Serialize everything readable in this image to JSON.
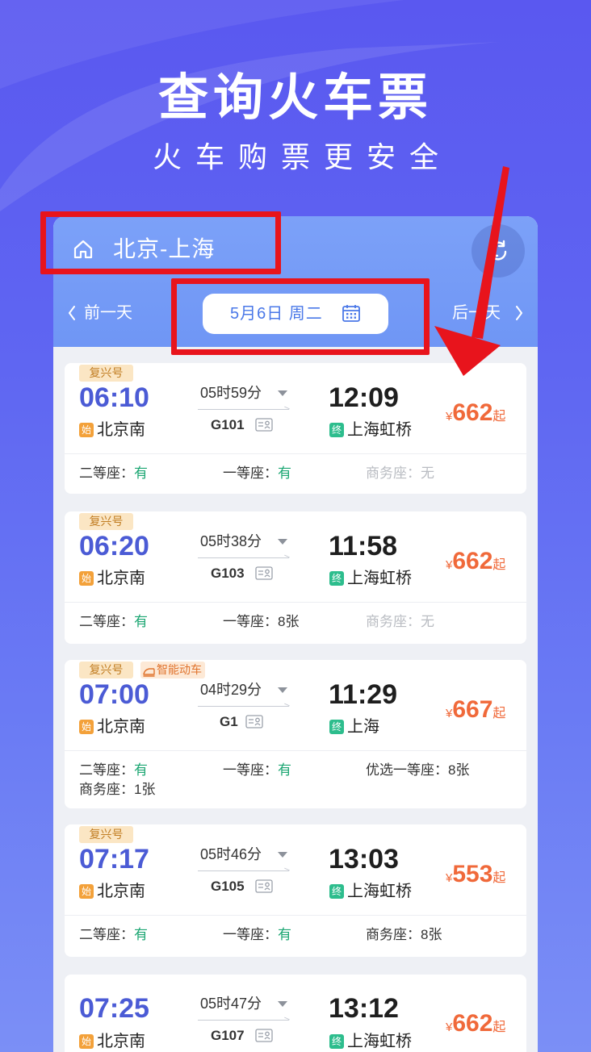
{
  "promo": {
    "title": "查询火车票",
    "subtitle": "火车购票更安全"
  },
  "route": {
    "label": "北京-上海"
  },
  "date_nav": {
    "prev_label": "前一天",
    "date_label": "5月6日 周二",
    "next_label": "后一天"
  },
  "trains": [
    {
      "badges": [
        "复兴号"
      ],
      "depart_time": "06:10",
      "depart_tag": "始",
      "depart_station": "北京南",
      "duration": "05时59分",
      "train_no": "G101",
      "arrive_time": "12:09",
      "arrive_tag": "终",
      "arrive_station": "上海虹桥",
      "price": {
        "currency": "¥",
        "amount": "662",
        "suffix": "起"
      },
      "seats": [
        {
          "label": "二等座：",
          "status": "有"
        },
        {
          "label": "一等座：",
          "status": "有"
        },
        {
          "label": "商务座：",
          "status": "无"
        }
      ]
    },
    {
      "badges": [
        "复兴号"
      ],
      "depart_time": "06:20",
      "depart_tag": "始",
      "depart_station": "北京南",
      "duration": "05时38分",
      "train_no": "G103",
      "arrive_time": "11:58",
      "arrive_tag": "终",
      "arrive_station": "上海虹桥",
      "price": {
        "currency": "¥",
        "amount": "662",
        "suffix": "起"
      },
      "seats": [
        {
          "label": "二等座：",
          "status": "有"
        },
        {
          "label": "一等座：",
          "status": "8张"
        },
        {
          "label": "商务座：",
          "status": "无"
        }
      ]
    },
    {
      "badges": [
        "复兴号",
        "智能动车"
      ],
      "depart_time": "07:00",
      "depart_tag": "始",
      "depart_station": "北京南",
      "duration": "04时29分",
      "train_no": "G1",
      "arrive_time": "11:29",
      "arrive_tag": "终",
      "arrive_station": "上海",
      "price": {
        "currency": "¥",
        "amount": "667",
        "suffix": "起"
      },
      "seats": [
        {
          "label": "二等座：",
          "status": "有"
        },
        {
          "label": "一等座：",
          "status": "有"
        },
        {
          "label": "优选一等座：",
          "status": "8张"
        },
        {
          "label": "商务座：",
          "status": "1张"
        }
      ]
    },
    {
      "badges": [
        "复兴号"
      ],
      "depart_time": "07:17",
      "depart_tag": "始",
      "depart_station": "北京南",
      "duration": "05时46分",
      "train_no": "G105",
      "arrive_time": "13:03",
      "arrive_tag": "终",
      "arrive_station": "上海虹桥",
      "price": {
        "currency": "¥",
        "amount": "553",
        "suffix": "起"
      },
      "seats": [
        {
          "label": "二等座：",
          "status": "有"
        },
        {
          "label": "一等座：",
          "status": "有"
        },
        {
          "label": "商务座：",
          "status": "8张"
        }
      ]
    },
    {
      "badges": [],
      "depart_time": "07:25",
      "depart_tag": "始",
      "depart_station": "北京南",
      "duration": "05时47分",
      "train_no": "G107",
      "arrive_time": "13:12",
      "arrive_tag": "终",
      "arrive_station": "上海虹桥",
      "price": {
        "currency": "¥",
        "amount": "662",
        "suffix": "起"
      }
    }
  ],
  "colors": {
    "background": "#5a58f0",
    "header": "#7299f6",
    "depart_time": "#4b5bd5",
    "price": "#f0693a",
    "available": "#1ba672",
    "unavailable": "#b9bcc2",
    "badge": "#fbe6c4",
    "annotation": "#e8141c"
  }
}
